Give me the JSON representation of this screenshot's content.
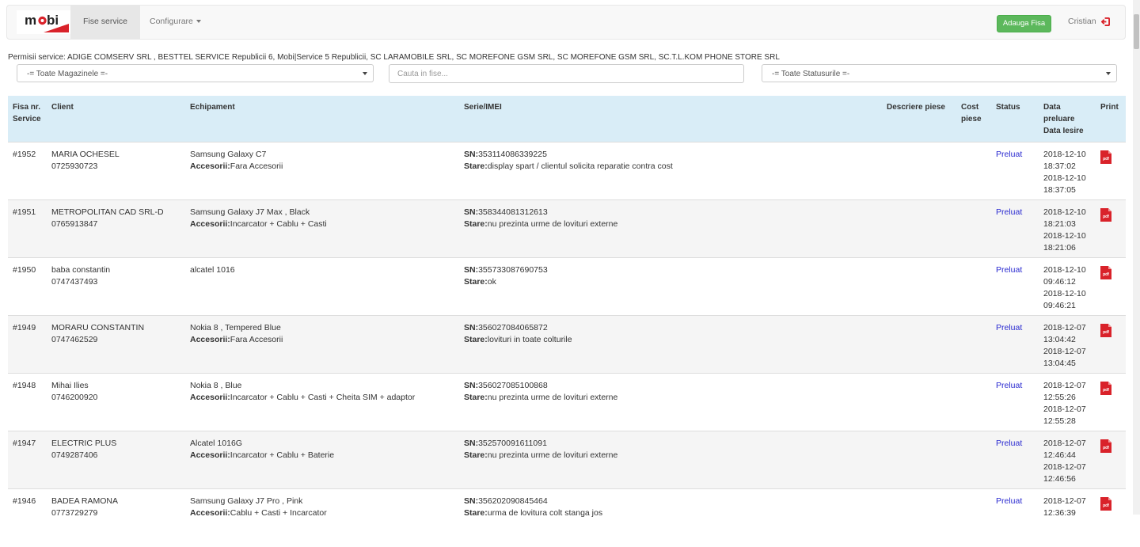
{
  "navbar": {
    "brand": "mobi",
    "active_tab": "Fise service",
    "config_menu": "Configurare",
    "add_button": "Adauga Fisa",
    "user": "Cristian",
    "colors": {
      "brand_red": "#d9222a",
      "add_green": "#5cb85c"
    }
  },
  "permisii": "Permisii service: ADIGE COMSERV SRL , BESTTEL SERVICE Republicii 6, Mobi|Service 5 Republicii, SC LARAMOBILE SRL, SC MOREFONE GSM SRL, SC MOREFONE GSM SRL, SC.T.L.KOM PHONE STORE SRL",
  "filters": {
    "stores": "-= Toate Magazinele =-",
    "search_placeholder": "Cauta in fise...",
    "statuses": "-= Toate Statusurile =-"
  },
  "table": {
    "headers": {
      "nr_l1": "Fisa nr.",
      "nr_l2": "Service",
      "client": "Client",
      "device": "Echipament",
      "serial": "Serie/IMEI",
      "parts": "Descriere piese",
      "cost_l1": "Cost",
      "cost_l2": "piese",
      "status": "Status",
      "date_l1": "Data",
      "date_l2": "preluare",
      "date_l3": "Data Iesire",
      "print": "Print"
    },
    "labels": {
      "sn": "SN:",
      "stare": "Stare:",
      "acc": "Accesorii:",
      "pdf": "pdf"
    },
    "rows": [
      {
        "nr": "#1952",
        "name": "MARIA OCHESEL",
        "phone": "0725930723",
        "device": "Samsung Galaxy C7",
        "acc": "Fara Accesorii",
        "sn": "353114086339225",
        "stare": "display spart / clientul solicita reparatie contra cost",
        "status": "Preluat",
        "d1": "2018-12-10",
        "t1": "18:37:02",
        "d2": "2018-12-10",
        "t2": "18:37:05"
      },
      {
        "nr": "#1951",
        "name": "METROPOLITAN CAD SRL-D",
        "phone": "0765913847",
        "device": "Samsung Galaxy J7 Max , Black",
        "acc": "Incarcator + Cablu + Casti",
        "sn": "358344081312613",
        "stare": "nu prezinta urme de lovituri externe",
        "status": "Preluat",
        "d1": "2018-12-10",
        "t1": "18:21:03",
        "d2": "2018-12-10",
        "t2": "18:21:06"
      },
      {
        "nr": "#1950",
        "name": "baba constantin",
        "phone": "0747437493",
        "device": "alcatel 1016",
        "acc": "",
        "sn": "355733087690753",
        "stare": "ok",
        "status": "Preluat",
        "d1": "2018-12-10",
        "t1": "09:46:12",
        "d2": "2018-12-10",
        "t2": "09:46:21"
      },
      {
        "nr": "#1949",
        "name": "MORARU CONSTANTIN",
        "phone": "0747462529",
        "device": "Nokia 8 , Tempered Blue",
        "acc": "Fara Accesorii",
        "sn": "356027084065872",
        "stare": "lovituri in toate colturile",
        "status": "Preluat",
        "d1": "2018-12-07",
        "t1": "13:04:42",
        "d2": "2018-12-07",
        "t2": "13:04:45"
      },
      {
        "nr": "#1948",
        "name": "Mihai Ilies",
        "phone": "0746200920",
        "device": "Nokia 8 , Blue",
        "acc": "Incarcator + Cablu + Casti + Cheita SIM + adaptor",
        "sn": "356027085100868",
        "stare": "nu prezinta urme de lovituri externe",
        "status": "Preluat",
        "d1": "2018-12-07",
        "t1": "12:55:26",
        "d2": "2018-12-07",
        "t2": "12:55:28"
      },
      {
        "nr": "#1947",
        "name": "ELECTRIC PLUS",
        "phone": "0749287406",
        "device": "Alcatel 1016G",
        "acc": "Incarcator + Cablu + Baterie",
        "sn": "352570091611091",
        "stare": "nu prezinta urme de lovituri externe",
        "status": "Preluat",
        "d1": "2018-12-07",
        "t1": "12:46:44",
        "d2": "2018-12-07",
        "t2": "12:46:56"
      },
      {
        "nr": "#1946",
        "name": "BADEA RAMONA",
        "phone": "0773729279",
        "device": "Samsung Galaxy J7 Pro , Pink",
        "acc": "Cablu + Casti + Incarcator",
        "sn": "356202090845464",
        "stare": "urma de lovitura colt stanga jos",
        "status": "Preluat",
        "d1": "2018-12-07",
        "t1": "12:36:39",
        "d2": "",
        "t2": ""
      }
    ]
  }
}
